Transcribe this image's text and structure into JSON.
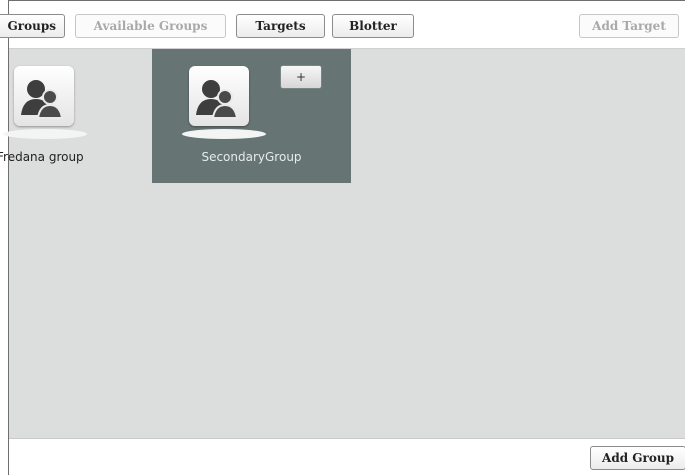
{
  "toolbar": {
    "tabs": [
      {
        "label": "Groups",
        "state": "partial"
      },
      {
        "label": "Available Groups",
        "state": "disabled"
      },
      {
        "label": "Targets",
        "state": "active"
      },
      {
        "label": "Blotter",
        "state": "active"
      }
    ],
    "add_target_label": "Add Target"
  },
  "groups": [
    {
      "name": "Fredana group",
      "icon": "user-group-icon",
      "selected": false
    },
    {
      "name": "SecondaryGroup",
      "icon": "user-group-icon",
      "selected": true,
      "add_label": "+"
    }
  ],
  "footer": {
    "add_group_label": "Add Group"
  },
  "colors": {
    "content_bg": "#dcdddd",
    "selected_bg": "#667474",
    "disabled_text": "#a9a9a9"
  }
}
